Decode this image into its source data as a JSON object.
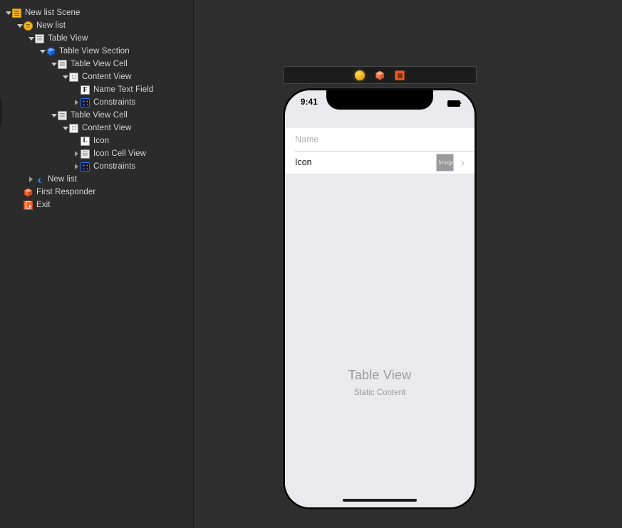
{
  "outline": {
    "name": "document-outline",
    "rows": [
      {
        "label": "New list Scene",
        "depth": 0,
        "twisty": "open",
        "icon": "scene-icon",
        "icon_class": "ic-scene"
      },
      {
        "label": "New list",
        "depth": 1,
        "twisty": "open",
        "icon": "view-controller-icon",
        "icon_class": "ic-vc"
      },
      {
        "label": "Table View",
        "depth": 2,
        "twisty": "open",
        "icon": "table-view-icon",
        "icon_class": "ic-tableview"
      },
      {
        "label": "Table View Section",
        "depth": 3,
        "twisty": "open",
        "icon": "section-cube-icon",
        "icon_class": "ic-section"
      },
      {
        "label": "Table View Cell",
        "depth": 4,
        "twisty": "open",
        "icon": "table-view-cell-icon",
        "icon_class": "ic-tableview"
      },
      {
        "label": "Content View",
        "depth": 5,
        "twisty": "open",
        "icon": "content-view-icon",
        "icon_class": "ic-contentview"
      },
      {
        "label": "Name Text Field",
        "depth": 6,
        "twisty": "none",
        "icon": "text-field-icon",
        "icon_class": "ic-textfield"
      },
      {
        "label": "Constraints",
        "depth": 6,
        "twisty": "closed",
        "icon": "constraints-icon",
        "icon_class": "ic-constraints"
      },
      {
        "label": "Table View Cell",
        "depth": 4,
        "twisty": "open",
        "icon": "table-view-cell-icon",
        "icon_class": "ic-tableview"
      },
      {
        "label": "Content View",
        "depth": 5,
        "twisty": "open",
        "icon": "content-view-icon",
        "icon_class": "ic-contentview"
      },
      {
        "label": "Icon",
        "depth": 6,
        "twisty": "none",
        "icon": "label-icon",
        "icon_class": "ic-label"
      },
      {
        "label": "Icon Cell View",
        "depth": 6,
        "twisty": "closed",
        "icon": "table-view-icon",
        "icon_class": "ic-tableview"
      },
      {
        "label": "Constraints",
        "depth": 6,
        "twisty": "closed",
        "icon": "constraints-icon",
        "icon_class": "ic-constraints"
      },
      {
        "label": "New list",
        "depth": 2,
        "twisty": "closed",
        "icon": "navigation-item-icon",
        "icon_class": "ic-navitem"
      },
      {
        "label": "First Responder",
        "depth": 1,
        "twisty": "none",
        "icon": "first-responder-icon",
        "icon_class": "ic-responder"
      },
      {
        "label": "Exit",
        "depth": 1,
        "twisty": "none",
        "icon": "exit-icon",
        "icon_class": "ic-exit"
      }
    ]
  },
  "canvas": {
    "scene_dock": {
      "items": [
        {
          "name": "view-controller-dock-icon",
          "icon": "view-controller-circle"
        },
        {
          "name": "first-responder-dock-icon",
          "icon": "orange-cube"
        },
        {
          "name": "exit-dock-icon",
          "icon": "orange-exit-square"
        }
      ]
    },
    "device": {
      "status_bar": {
        "time": "9:41",
        "battery_icon": "battery-full-icon"
      },
      "table": {
        "cells": [
          {
            "type": "text-field",
            "placeholder": "Name"
          },
          {
            "type": "icon-row",
            "title": "Icon",
            "image_placeholder": "Image",
            "accessory": "disclosure-chevron"
          }
        ],
        "placeholder_title": "Table View",
        "placeholder_subtitle": "Static Content"
      },
      "home_indicator": "home-indicator"
    }
  },
  "colors": {
    "panel_bg": "#2b2b2b",
    "canvas_bg": "#2e2e2e",
    "accent_orange": "#f0b323",
    "accent_blue": "#1f6cf0",
    "exit_orange": "#f4632e",
    "screen_bg": "#e9e9ee"
  }
}
